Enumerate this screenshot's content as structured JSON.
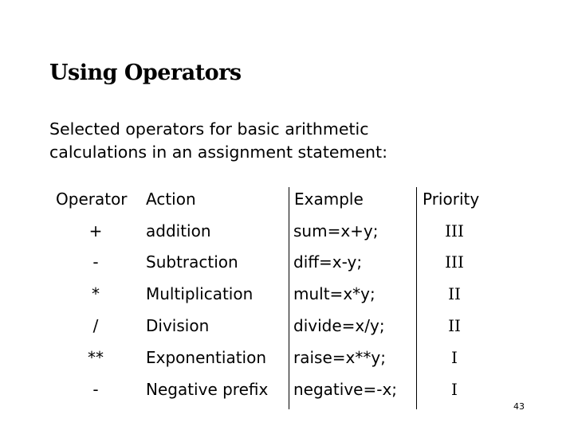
{
  "slide": {
    "title": "Using Operators",
    "intro_lines": [
      "Selected operators for basic arithmetic",
      "calculations in an assignment statement:"
    ],
    "page_number": "43"
  },
  "table": {
    "headers": {
      "operator": "Operator",
      "action": "Action",
      "example": "Example",
      "priority": "Priority"
    },
    "rows": [
      {
        "operator": "+",
        "action": "addition",
        "example": "sum=x+y;",
        "priority": "III"
      },
      {
        "operator": "-",
        "action": "Subtraction",
        "example": "diff=x-y;",
        "priority": "III"
      },
      {
        "operator": "*",
        "action": "Multiplication",
        "example": "mult=x*y;",
        "priority": "II"
      },
      {
        "operator": "/",
        "action": "Division",
        "example": "divide=x/y;",
        "priority": "II"
      },
      {
        "operator": "**",
        "action": "Exponentiation",
        "example": "raise=x**y;",
        "priority": "I"
      },
      {
        "operator": "-",
        "action": "Negative prefix",
        "example": "negative=-x;",
        "priority": "I"
      }
    ]
  }
}
